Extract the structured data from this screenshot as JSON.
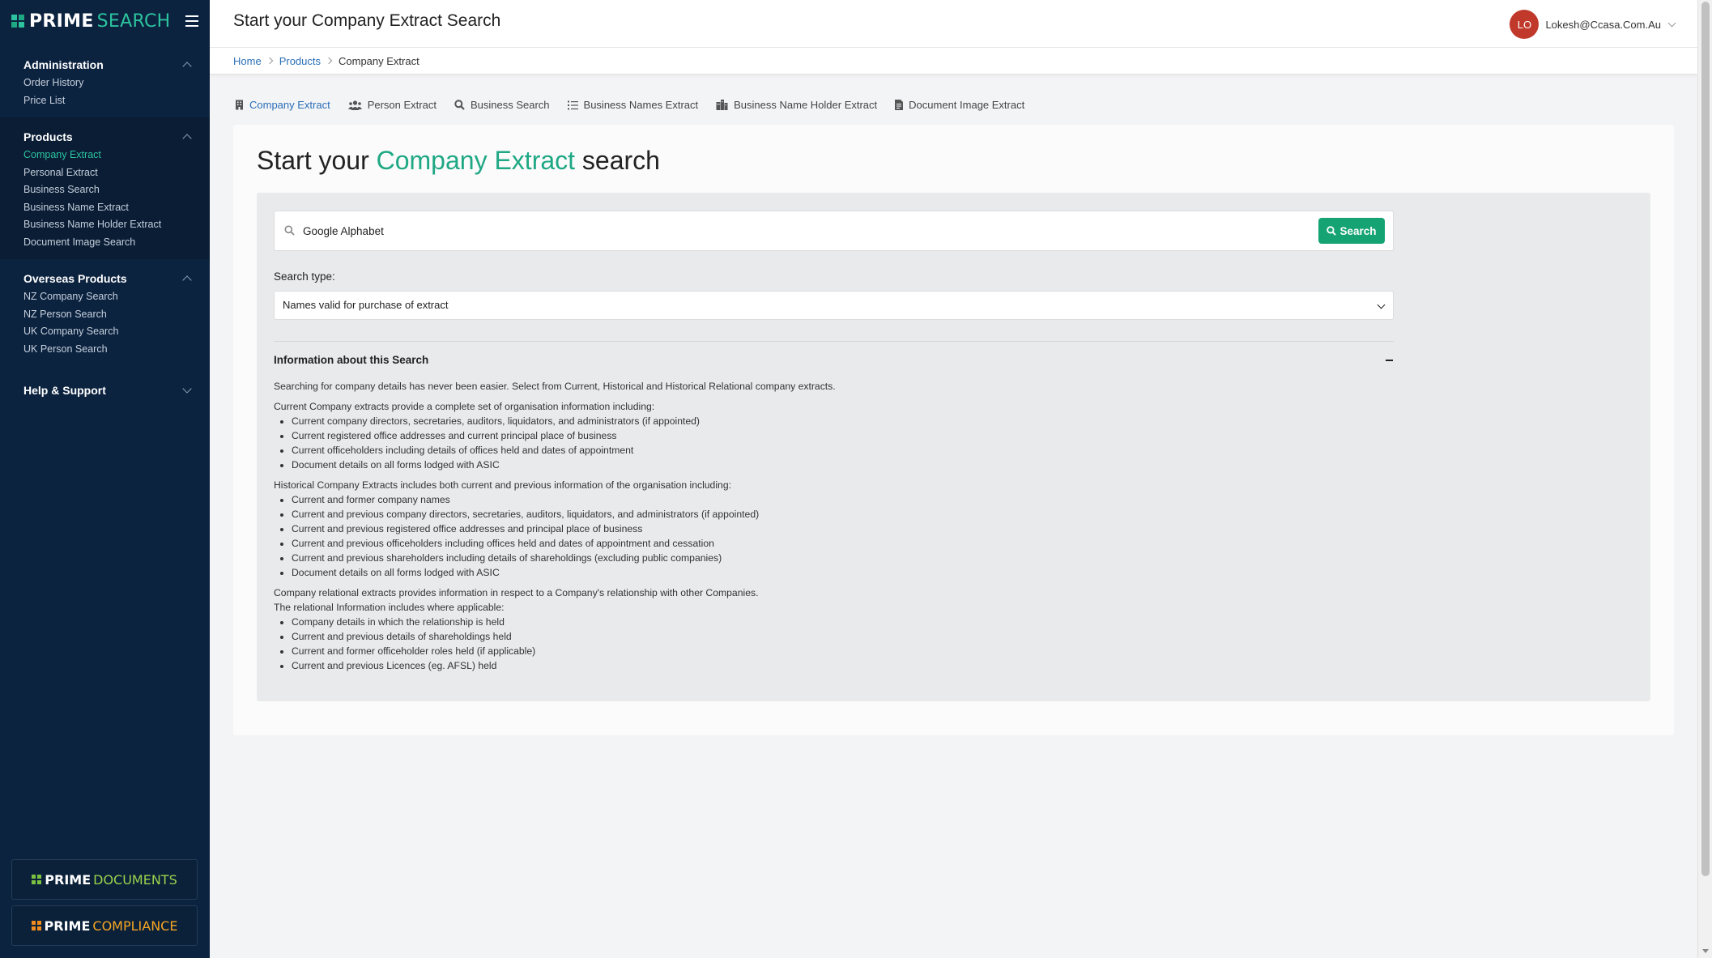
{
  "brand": {
    "prime": "PRIME",
    "accent": "SEARCH",
    "accent_color": "#2cc39e",
    "grid_colors": [
      "#2cc39e",
      "#1fa884",
      "#2cc39e",
      "#1fa884"
    ]
  },
  "sidebar": {
    "groups": [
      {
        "title": "Administration",
        "expanded": true,
        "items": [
          "Order History",
          "Price List"
        ]
      },
      {
        "title": "Products",
        "expanded": true,
        "items": [
          "Company Extract",
          "Personal Extract",
          "Business Search",
          "Business Name Extract",
          "Business Name Holder Extract",
          "Document Image Search"
        ],
        "active_item": "Company Extract"
      },
      {
        "title": "Overseas Products",
        "expanded": true,
        "items": [
          "NZ Company Search",
          "NZ Person Search",
          "UK Company Search",
          "UK Person Search"
        ]
      },
      {
        "title": "Help & Support",
        "expanded": false,
        "items": []
      }
    ],
    "bottom_brands": [
      {
        "prime": "PRIME",
        "accent": "DOCUMENTS",
        "accent_color": "#9bd34c",
        "grid_color": "#7cc242"
      },
      {
        "prime": "PRIME",
        "accent": "COMPLIANCE",
        "accent_color": "#f5a623",
        "grid_color": "#f08c1e"
      }
    ]
  },
  "header": {
    "title": "Start your Company Extract Search",
    "user": {
      "initials": "LO",
      "email": "Lokesh@Ccasa.Com.Au"
    }
  },
  "breadcrumb": [
    "Home",
    "Products",
    "Company Extract"
  ],
  "tabs": [
    {
      "label": "Company Extract",
      "icon": "building-icon",
      "active": true
    },
    {
      "label": "Person Extract",
      "icon": "users-icon",
      "active": false
    },
    {
      "label": "Business Search",
      "icon": "search-icon",
      "active": false
    },
    {
      "label": "Business Names Extract",
      "icon": "list-icon",
      "active": false
    },
    {
      "label": "Business Name Holder Extract",
      "icon": "city-icon",
      "active": false
    },
    {
      "label": "Document Image Extract",
      "icon": "document-icon",
      "active": false
    }
  ],
  "main": {
    "heading_prefix": "Start your ",
    "heading_accent": "Company Extract",
    "heading_suffix": " search",
    "search": {
      "value": "Google Alphabet",
      "button": "Search"
    },
    "search_type_label": "Search type:",
    "search_type_value": "Names valid for purchase of extract",
    "info_title": "Information about this Search",
    "info": {
      "intro": "Searching for company details has never been easier. Select from Current, Historical and Historical Relational company extracts.",
      "current_head": "Current Company extracts provide a complete set of organisation information including:",
      "current_items": [
        "Current company directors, secretaries, auditors, liquidators, and administrators (if appointed)",
        "Current registered office addresses and current principal place of business",
        "Current officeholders including details of offices held and dates of appointment",
        "Document details on all forms lodged with ASIC"
      ],
      "historical_head": "Historical Company Extracts includes both current and previous information of the organisation including:",
      "historical_items": [
        "Current and former company names",
        "Current and previous company directors, secretaries, auditors, liquidators, and administrators (if appointed)",
        "Current and previous registered office addresses and principal place of business",
        "Current and previous officeholders including offices held and dates of appointment and cessation",
        "Current and previous shareholders including details of shareholdings (excluding public companies)",
        "Document details on all forms lodged with ASIC"
      ],
      "relational_head1": "Company relational extracts provides information in respect to a Company's relationship with other Companies.",
      "relational_head2": "The relational Information includes where applicable:",
      "relational_items": [
        "Company details in which the relationship is held",
        "Current and previous details of shareholdings held",
        "Current and former officeholder roles held (if applicable)",
        "Current and previous Licences (eg. AFSL) held"
      ]
    }
  }
}
